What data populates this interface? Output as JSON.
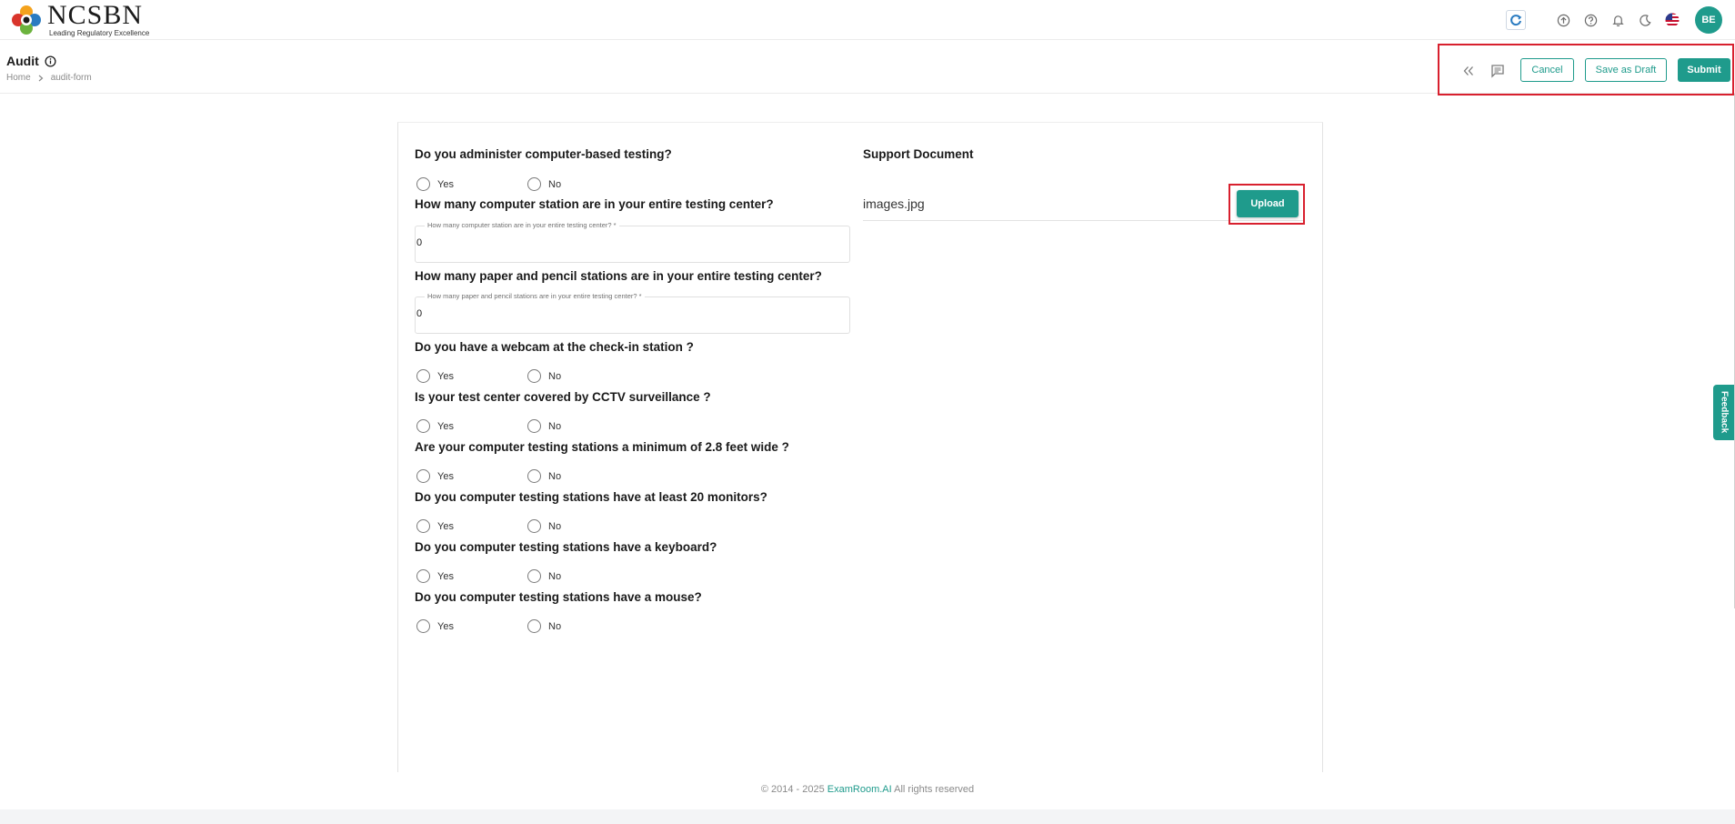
{
  "header": {
    "logo_title": "NCSBN",
    "logo_subtitle": "Leading Regulatory Excellence",
    "avatar_initials": "BE"
  },
  "subheader": {
    "title": "Audit",
    "breadcrumb": [
      "Home",
      "audit-form"
    ],
    "cancel_label": "Cancel",
    "draft_label": "Save as Draft",
    "submit_label": "Submit"
  },
  "form": {
    "questions": [
      {
        "text": "Do you administer computer-based testing?",
        "type": "radio"
      },
      {
        "text": "How many computer station are in your entire testing center?",
        "type": "input",
        "field_label": "How many computer station are in your entire testing center? *",
        "value": "0"
      },
      {
        "text": "How many paper and pencil stations are in your entire testing center?",
        "type": "input",
        "field_label": "How many paper and pencil stations are in your entire testing center? *",
        "value": "0"
      },
      {
        "text": "Do you have a webcam at the check-in station ?",
        "type": "radio"
      },
      {
        "text": "Is your test center covered by CCTV surveillance ?",
        "type": "radio"
      },
      {
        "text": "Are your computer testing stations a minimum of 2.8 feet wide ?",
        "type": "radio"
      },
      {
        "text": "Do you computer testing stations have at least 20 monitors?",
        "type": "radio"
      },
      {
        "text": "Do you computer testing stations have a keyboard?",
        "type": "radio"
      },
      {
        "text": "Do you computer testing stations have a mouse?",
        "type": "radio"
      }
    ],
    "yes_label": "Yes",
    "no_label": "No"
  },
  "support": {
    "title": "Support Document",
    "file_name": "images.jpg",
    "upload_label": "Upload"
  },
  "footer": {
    "prefix": "© 2014 - 2025 ",
    "brand": "ExamRoom.AI",
    "suffix": " All rights reserved"
  },
  "feedback_label": "Feedback",
  "colors": {
    "accent": "#1f9b8c",
    "highlight": "#d8202e"
  }
}
